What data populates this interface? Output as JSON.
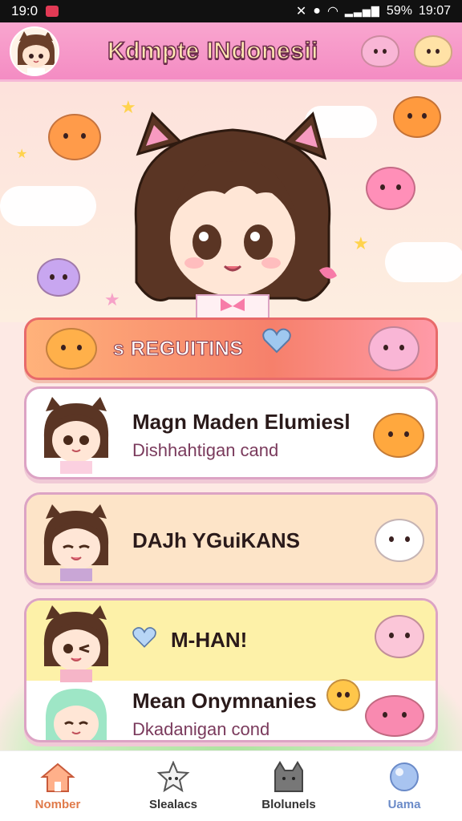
{
  "status_bar": {
    "time_left": "19:0",
    "battery": "59%",
    "time_right": "19:07"
  },
  "header": {
    "title": "Kdmpte INdonesii"
  },
  "banner": {
    "label": "s REGUITINS"
  },
  "cards": [
    {
      "title": "Magn Maden Elumiesl",
      "subtitle": "Dishhahtigan cand"
    },
    {
      "title": "DAJh YGuiKANS",
      "subtitle": ""
    },
    {
      "title": "M-HAN!",
      "subtitle": ""
    },
    {
      "title": "Mean Onymnanies",
      "subtitle": "Dkadanigan cond"
    }
  ],
  "nav": [
    {
      "label": "Nomber",
      "icon": "house-icon"
    },
    {
      "label": "Slealacs",
      "icon": "star-pet-icon"
    },
    {
      "label": "Blolunels",
      "icon": "cat-icon"
    },
    {
      "label": "Uama",
      "icon": "circle-icon"
    }
  ],
  "colors": {
    "header_pink": "#f48cc3",
    "banner_orange": "#f6806b",
    "card_border": "#dca3c4",
    "nav_active": "#e07a4a"
  }
}
